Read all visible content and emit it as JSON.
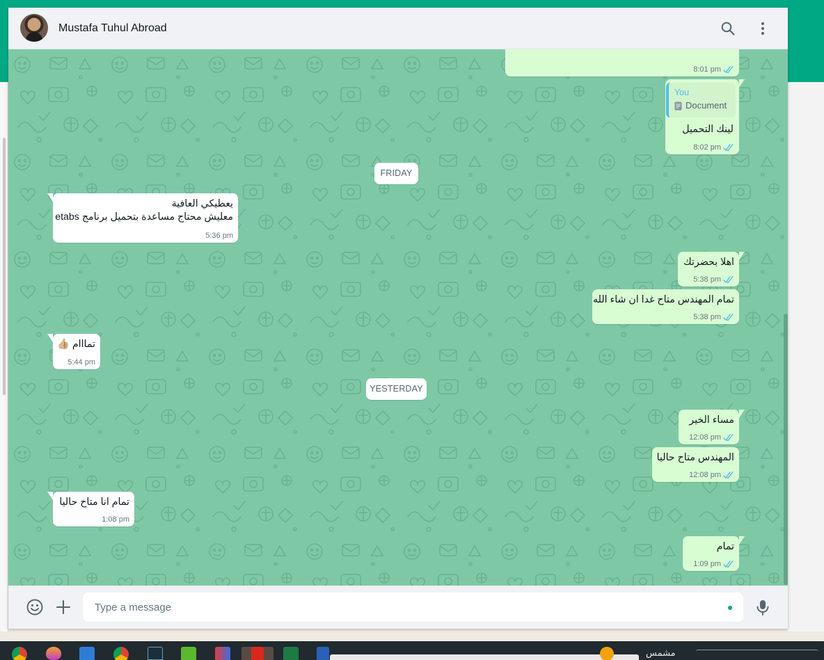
{
  "header": {
    "contact_name": "Mustafa Tuhul Abroad"
  },
  "colors": {
    "accent": "#00a884",
    "outgoing": "#d9fdd3",
    "incoming": "#ffffff",
    "wallpaper": "#7fc8a6",
    "read_tick": "#53bdeb"
  },
  "messages": {
    "m0": {
      "time": "8:01 pm"
    },
    "m1": {
      "quote_name": "You",
      "quote_doc": "Document",
      "text": "لينك التحميل",
      "time": "8:02 pm"
    },
    "d1": "FRIDAY",
    "m2": {
      "line1": "يعطيكي العافية",
      "line2": "معليش محتاج مساعدة بتحميل برنامج etabs",
      "time": "5:36 pm"
    },
    "m3": {
      "text": "اهلا بحضرتك",
      "time": "5:38 pm"
    },
    "m4": {
      "text": "تمام المهندس متاح غدا ان شاء الله",
      "time": "5:38 pm"
    },
    "m5": {
      "text": "تمااام 👍🏼",
      "time": "5:44 pm"
    },
    "d2": "YESTERDAY",
    "m6": {
      "text": "مساء الخير",
      "time": "12:08 pm"
    },
    "m7": {
      "text": "المهندس متاح حاليا",
      "time": "12:08 pm"
    },
    "m8": {
      "text": "تمام انا متاح حاليا",
      "time": "1:08 pm"
    },
    "m9": {
      "text": "تمام",
      "time": "1:09 pm"
    }
  },
  "composer": {
    "placeholder": "Type a message"
  },
  "taskbar": {
    "label": "مشمس"
  }
}
